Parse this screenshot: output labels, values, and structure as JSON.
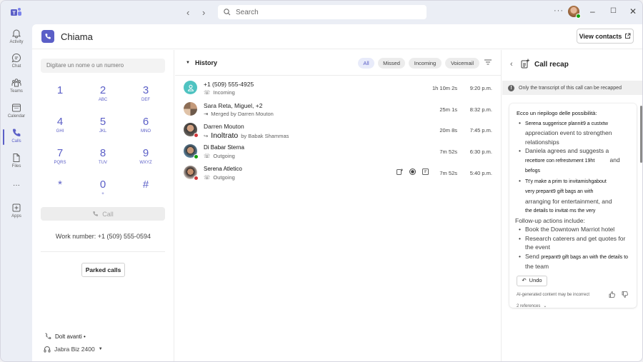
{
  "titlebar": {
    "search_placeholder": "Search",
    "more_label": "···"
  },
  "rail": {
    "items": [
      {
        "label": "Activity",
        "icon": "bell-icon"
      },
      {
        "label": "Chat",
        "icon": "chat-icon"
      },
      {
        "label": "Teams",
        "icon": "teams-icon"
      },
      {
        "label": "Calendar",
        "icon": "calendar-icon"
      },
      {
        "label": "Calls",
        "icon": "phone-icon",
        "active": true
      },
      {
        "label": "Files",
        "icon": "file-icon"
      },
      {
        "label": "···",
        "icon": "more-icon"
      },
      {
        "label": "Apps",
        "icon": "apps-icon"
      }
    ]
  },
  "header": {
    "title": "Chiama",
    "view_contacts": "View contacts"
  },
  "dialer": {
    "input_placeholder": "Digitare un nome o un numero",
    "keys": [
      {
        "digit": "1",
        "letters": ""
      },
      {
        "digit": "2",
        "letters": "ABC"
      },
      {
        "digit": "3",
        "letters": "DEF"
      },
      {
        "digit": "4",
        "letters": "GHI"
      },
      {
        "digit": "5",
        "letters": "JKL"
      },
      {
        "digit": "6",
        "letters": "MNO"
      },
      {
        "digit": "7",
        "letters": "PQRS"
      },
      {
        "digit": "8",
        "letters": "TUV"
      },
      {
        "digit": "9",
        "letters": "WXYZ"
      },
      {
        "digit": "*",
        "letters": ""
      },
      {
        "digit": "0",
        "letters": "+"
      },
      {
        "digit": "#",
        "letters": ""
      }
    ],
    "call_label": "Call",
    "work_number": "Work number: +1 (509) 555-0594",
    "parked_calls": "Parked calls",
    "forward_label": "Dolt avanti •",
    "device_label": "Jabra Biz 2400"
  },
  "history": {
    "title": "History",
    "filters": [
      {
        "label": "All",
        "active": true
      },
      {
        "label": "Missed"
      },
      {
        "label": "Incoming"
      },
      {
        "label": "Voicemail"
      }
    ],
    "rows": [
      {
        "name": "+1 (509) 555-4925",
        "sub": "Incoming",
        "duration": "1h 10m 2s",
        "time": "9:20 p.m."
      },
      {
        "name": "Sara   Reta, Miguel, +2",
        "sub": "Merged by Darren Mouton",
        "duration": "25m 1s",
        "time": "8:32 p.m."
      },
      {
        "name": "Darren Mouton",
        "sub_overlay": "Inoltrato",
        "sub": "by Babak Shammas",
        "duration": "20m 8s",
        "time": "7:45 p.m."
      },
      {
        "name": "Di Babar Sterna",
        "sub": "Outgoing",
        "duration": "7m 52s",
        "time": "6:30 p.m."
      },
      {
        "name": "Serena Atletico",
        "sub": "Outgoing",
        "duration": "7m 52s",
        "time": "5:40 p.m."
      }
    ]
  },
  "recap": {
    "title": "Call recap",
    "notice": "Only the transcript of this call can be recapped",
    "intro": "Ecco un riepilogo delle possibilità:",
    "bullets": [
      {
        "a": "Serena suggerisce plannit9 a custxtw",
        "b": "appreciation event to strengthen relationships"
      },
      {
        "a": "Daniela agrees and suggests a",
        "b": "recettore con refrestvment 19ht",
        "c": "and",
        "d": "befogs"
      },
      {
        "a": "Tt'y make a prim to invitamishgabout",
        "b": "very prepant9 gift bags an with",
        "c": "arranging for entertainment, and",
        "d": "the details to invitat·ms the very"
      }
    ],
    "followup_title": "Follow-up actions include:",
    "followups": [
      "Book the Downtown Marriot hotel",
      "Research caterers and get quotes for the event"
    ],
    "followup_last_a": "Send",
    "followup_last_b": "prepant9 gift bags an with the details to",
    "followup_last_c": "the team",
    "undo": "Undo",
    "disclaimer": "AI-generated content may be incorrect",
    "references": "2 references"
  },
  "colors": {
    "accent": "#5b5fc7",
    "busy": "#d13438",
    "available": "#13a10e",
    "teal_avatar": "#4fc3c1"
  }
}
